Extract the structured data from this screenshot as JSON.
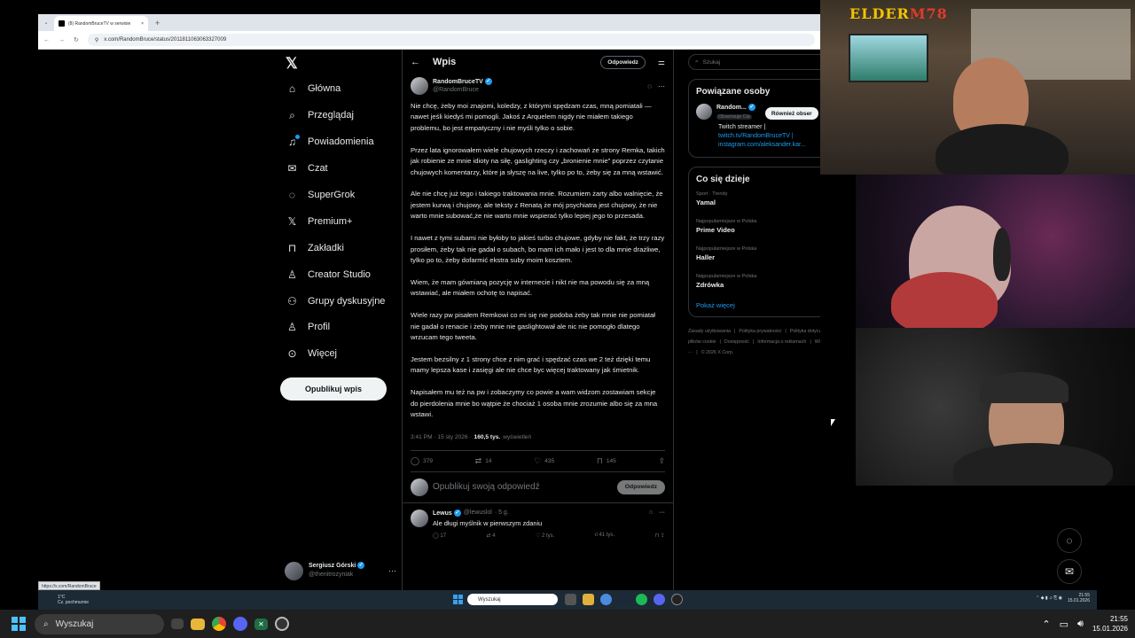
{
  "browser": {
    "tab_title": "(8) RandomBruceTV w serwisie",
    "tab_close": "×",
    "new_tab": "+",
    "url": "x.com/RandomBruce/status/2011811063063327009"
  },
  "nav": {
    "items": [
      {
        "label": "Główna",
        "icon": "home-icon",
        "glyph": "⌂"
      },
      {
        "label": "Przeglądaj",
        "icon": "search-icon",
        "glyph": "⌕"
      },
      {
        "label": "Powiadomienia",
        "icon": "bell-icon",
        "glyph": "♫"
      },
      {
        "label": "Czat",
        "icon": "mail-icon",
        "glyph": "✉"
      },
      {
        "label": "SuperGrok",
        "icon": "grok-icon",
        "glyph": "◌"
      },
      {
        "label": "Premium+",
        "icon": "x-premium-icon",
        "glyph": "𝕏"
      },
      {
        "label": "Zakładki",
        "icon": "bookmark-icon",
        "glyph": "⊓"
      },
      {
        "label": "Creator Studio",
        "icon": "creator-icon",
        "glyph": "♙"
      },
      {
        "label": "Grupy dyskusyjne",
        "icon": "communities-icon",
        "glyph": "⚇"
      },
      {
        "label": "Profil",
        "icon": "profile-icon",
        "glyph": "♙"
      },
      {
        "label": "Więcej",
        "icon": "more-circle-icon",
        "glyph": "⊙"
      }
    ],
    "post_button": "Opublikuj wpis",
    "account_name": "Sergiusz Górski",
    "account_handle": "@thenitrozyniak"
  },
  "main": {
    "header_title": "Wpis",
    "reply_button": "Odpowiedz",
    "author_name": "RandomBruceTV",
    "author_handle": "@RandomBruce",
    "paragraphs": [
      "Nie chcę, żeby moi znajomi, koledzy, z którymi spędzam czas, mną pomiatali — nawet jeśli kiedyś mi pomogli. Jakoś z Arquelem nigdy nie miałem takiego problemu, bo jest empatyczny i nie myśli tylko o sobie.",
      "Przez lata ignorowałem wiele chujowych rzeczy i zachowań ze strony Remka, takich jak robienie ze mnie idioty na siłę, gaslighting czy „bronienie mnie” poprzez czytanie chujowych komentarzy, które ja słyszę na live, tylko po to, żeby się za mną wstawić.",
      "Ale nie chcę już tego i takiego traktowania mnie. Rozumiem żarty albo walnięcie, że jestem kurwą i chujowy, ale teksty z Renatą  że mój psychiatra jest chujowy, że nie warto mnie subować,że nie warto mnie wspierać tylko lepiej jego  to przesada.",
      "I nawet z tymi subami nie byłoby to jakieś turbo chujowe, gdyby nie fakt, że trzy razy prosiłem, żeby tak nie gadał o subach, bo mam ich mało i jest to dla mnie drażliwe, tylko po to, żeby dofarmić ekstra suby moim kosztem.",
      "Wiem, że mam gównianą pozycję w internecie i nikt nie ma powodu się za mną wstawiać, ale miałem ochotę to napisać.",
      "Wiele razy pw pisałem Remkowi co mi się nie podoba żeby tak mnie nie pomiatał nie gadał o renacie i żeby mnie nie gaslightował ale nic nie pomogło dlatego wrzucam tego tweeta.",
      "Jestem bezsilny z 1 strony chce z nim grać i spędzać czas we 2 też dzięki temu mamy lepsza kase i zasięgi ale nie chce byc więcej traktowany jak śmietnik.",
      "Napisałem mu też na pw i zobaczymy co powie a wam widzom zostawiam sekcje do pierdolenia mnie bo wątpie że chociaż 1 osoba mnie zrozumie albo się za mna wstawi."
    ],
    "meta_time": "3:41 PM · 15 sty 2026 ·",
    "meta_views": "160,5 tys.",
    "meta_views_label": "wyświetleń",
    "actions": {
      "replies": "379",
      "reposts": "14",
      "likes": "435",
      "bookmarks": "145"
    },
    "composer_placeholder": "Opublikuj swoją odpowiedź",
    "composer_button": "Odpowiedz",
    "reply": {
      "name": "Lewus",
      "handle": "@lewuslol",
      "age": "· 5 g.",
      "text": "Ale długi myślnik w pierwszym zdaniu",
      "replies": "17",
      "reposts": "4",
      "likes": "2 tys.",
      "views": "41 tys."
    }
  },
  "right": {
    "search_placeholder": "Szukaj",
    "related_title": "Powiązane osoby",
    "related_name": "Random...",
    "related_badge": "Obserwuje Cię",
    "follow_button": "Również obser",
    "related_bio": "Twitch streamer |",
    "related_link1": "twitch.tv/RandomBruceTV |",
    "related_link2": "instagram.com/aleksander.kar...",
    "trends_title": "Co się dzieje",
    "trends": [
      {
        "context": "Sport · Trendy",
        "name": "Yamal"
      },
      {
        "context": "Najpopularniejsze w Polska",
        "name": "Prime Video"
      },
      {
        "context": "Najpopularniejsze w Polska",
        "name": "Haller"
      },
      {
        "context": "Najpopularniejsze w Polska",
        "name": "Zdrówka"
      }
    ],
    "show_more": "Pokaż więcej",
    "footer": [
      "Zasady użytkowania",
      "|",
      "Polityka prywatności",
      "|",
      "Polityka dotycząca plików cookie",
      "|",
      "Dostępność",
      "|",
      "Informacja o reklamach",
      "|",
      "Więcej ···",
      "|",
      "© 2026 X Corp."
    ]
  },
  "status_link": "https://x.com/RandomBruce",
  "overlay": {
    "channel_logo_1": "ELDER",
    "channel_logo_2": "M78"
  },
  "game_taskbar": {
    "weather_temp": "1°C",
    "weather_desc": "Cz. pochmurnie",
    "search": "Wyszukaj",
    "time": "21:55",
    "date": "15.01.2026"
  },
  "taskbar": {
    "search": "Wyszukaj",
    "time": "21:55",
    "date": "15.01.2026"
  }
}
